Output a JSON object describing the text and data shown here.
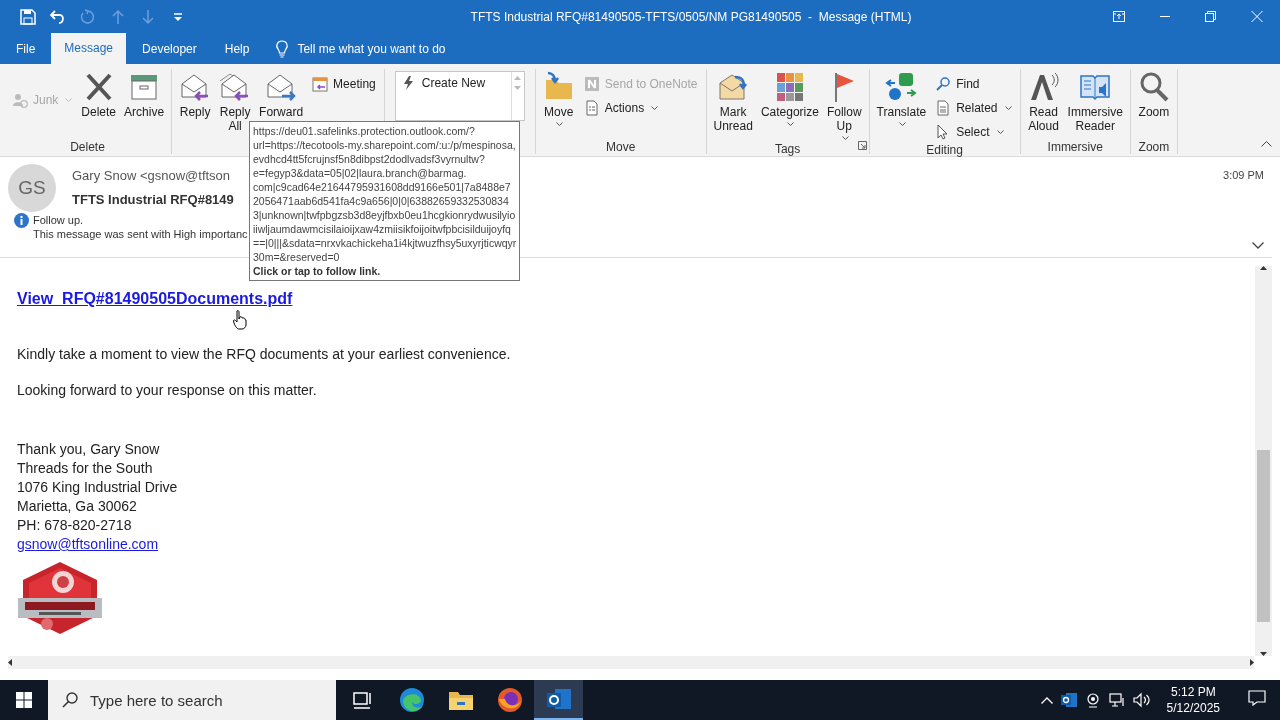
{
  "window": {
    "title": "TFTS Industrial RFQ#81490505-TFTS/0505/NM PG81490505  -  Message (HTML)"
  },
  "quick_access": [
    {
      "disabled": false
    },
    {
      "disabled": false
    },
    {
      "disabled": true
    },
    {
      "disabled": true
    },
    {
      "disabled": true
    },
    {
      "disabled": false
    }
  ],
  "menu_tabs": [
    {
      "label": "File",
      "selected": false
    },
    {
      "label": "Message",
      "selected": true
    },
    {
      "label": "Developer",
      "selected": false
    },
    {
      "label": "Help",
      "selected": false
    }
  ],
  "tell_me": {
    "placeholder": "Tell me what you want to do"
  },
  "ribbon": {
    "groups": [
      {
        "label": "Delete",
        "commands": [
          {
            "kind": "small",
            "label": "Junk",
            "disabled": true,
            "dropdown": true
          },
          {
            "kind": "large",
            "label": "Delete"
          },
          {
            "kind": "large",
            "label": "Archive"
          }
        ]
      },
      {
        "commands": [
          {
            "kind": "large",
            "label": "Reply"
          },
          {
            "kind": "large",
            "label": "Reply All"
          },
          {
            "kind": "large",
            "label": "Forward"
          },
          {
            "kind": "small",
            "label": "Meeting"
          }
        ]
      },
      {
        "commands": [
          {
            "kind": "gallery",
            "label": "Create New"
          }
        ]
      },
      {
        "label": "Move",
        "commands": [
          {
            "kind": "large",
            "label": "Move",
            "dropdown": true
          },
          {
            "kind": "small",
            "label": "Send to OneNote",
            "disabled": true
          },
          {
            "kind": "small",
            "label": "Actions",
            "dropdown": true
          }
        ]
      },
      {
        "label": "Tags",
        "launcher": true,
        "commands": [
          {
            "kind": "large",
            "label": "Mark Unread"
          },
          {
            "kind": "large",
            "label": "Categorize",
            "dropdown": true
          },
          {
            "kind": "large",
            "label": "Follow Up",
            "dropdown": true
          }
        ]
      },
      {
        "label": "Editing",
        "commands": [
          {
            "kind": "large",
            "label": "Translate",
            "dropdown": true
          },
          {
            "kind": "small",
            "label": "Find"
          },
          {
            "kind": "small",
            "label": "Related",
            "dropdown": true
          },
          {
            "kind": "small",
            "label": "Select",
            "dropdown": true
          }
        ]
      },
      {
        "label": "Immersive",
        "commands": [
          {
            "kind": "large",
            "label": "Read Aloud"
          },
          {
            "kind": "large",
            "label": "Immersive Reader"
          }
        ]
      },
      {
        "label": "Zoom",
        "commands": [
          {
            "kind": "large",
            "label": "Zoom"
          }
        ]
      }
    ]
  },
  "message": {
    "initials": "GS",
    "sender": "Gary Snow <gsnow@tftson",
    "subject": "TFTS Industrial RFQ#8149",
    "time": "3:09 PM",
    "info": [
      "Follow up.",
      "This message was sent with High importanc"
    ]
  },
  "body": {
    "link": "View_RFQ#81490505Documents.pdf",
    "paragraphs": [
      "Kindly take a moment to view the RFQ documents at your earliest convenience.",
      "Looking forward to your response on this matter."
    ],
    "signature": [
      "Thank you, Gary Snow",
      "Threads for the South",
      "1076 King Industrial Drive",
      "Marietta, Ga 30062",
      "PH: 678-820-2718"
    ],
    "email": "gsnow@tftsonline.com",
    "logo": {
      "kind": "picture"
    }
  },
  "tooltip": {
    "lines": [
      "https://deu01.safelinks.protection.outlook.com/?",
      "url=https://tecotools-my.sharepoint.com/:u:/p/mespinosa,",
      "evdhcd4tt5fcrujnsf5n8dibpst2dodlvadsf3vyrnultw?",
      "e=fegyp3&data=05|02|laura.branch@barmag.",
      "com|c9cad64e21644795931608dd9166e501|7a8488e7",
      "2056471aab6d541fa4c9a656|0|0|63882659332530834",
      "3|unknown|twfpbgzsb3d8eyjfbxb0eu1hcgkionrydwusilyio",
      "iiwljaumdawmcisilaioijxaw4zmiisikfoijoitwfpbcisilduijoyfq",
      "==|0|||&sdata=nrxvkachickeha1i4kjtwuzfhsy5uxyrjticwqyr",
      "30m=&reserved=0"
    ],
    "action": "Click or tap to follow link."
  },
  "taskbar": {
    "search": {
      "placeholder": "Type here to search"
    },
    "apps": [
      {
        "selected": false
      },
      {
        "selected": false
      },
      {
        "selected": false
      },
      {
        "selected": false
      },
      {
        "selected": true
      }
    ],
    "time": "5:12 PM",
    "date": "5/12/2025"
  }
}
